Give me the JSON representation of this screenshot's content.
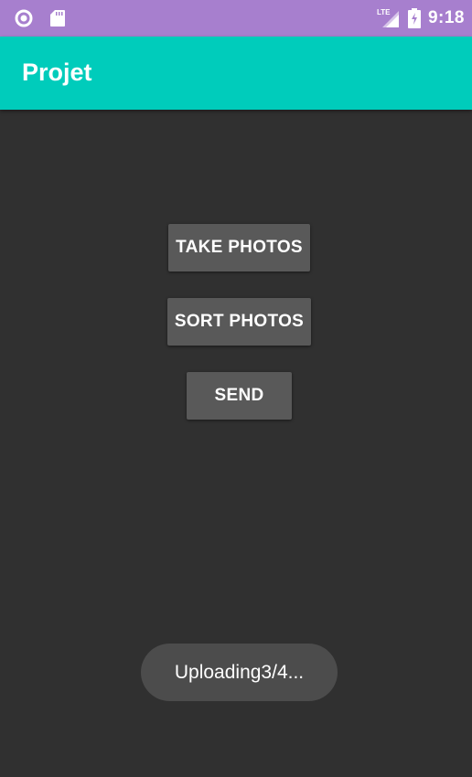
{
  "status_bar": {
    "time": "9:18",
    "network_label": "LTE",
    "icons": [
      "circle-icon",
      "sd-card-icon",
      "lte-signal-icon",
      "battery-charging-icon"
    ],
    "background": "#a77fce"
  },
  "app_bar": {
    "title": "Projet",
    "background": "#00ccbb"
  },
  "buttons": {
    "take_photos": "TAKE PHOTOS",
    "sort_photos": "SORT PHOTOS",
    "send": "SEND"
  },
  "toast": {
    "message": "Uploading3/4..."
  },
  "colors": {
    "screen_background": "#303030",
    "button_background": "#595959",
    "toast_background": "#4c4c4c"
  }
}
